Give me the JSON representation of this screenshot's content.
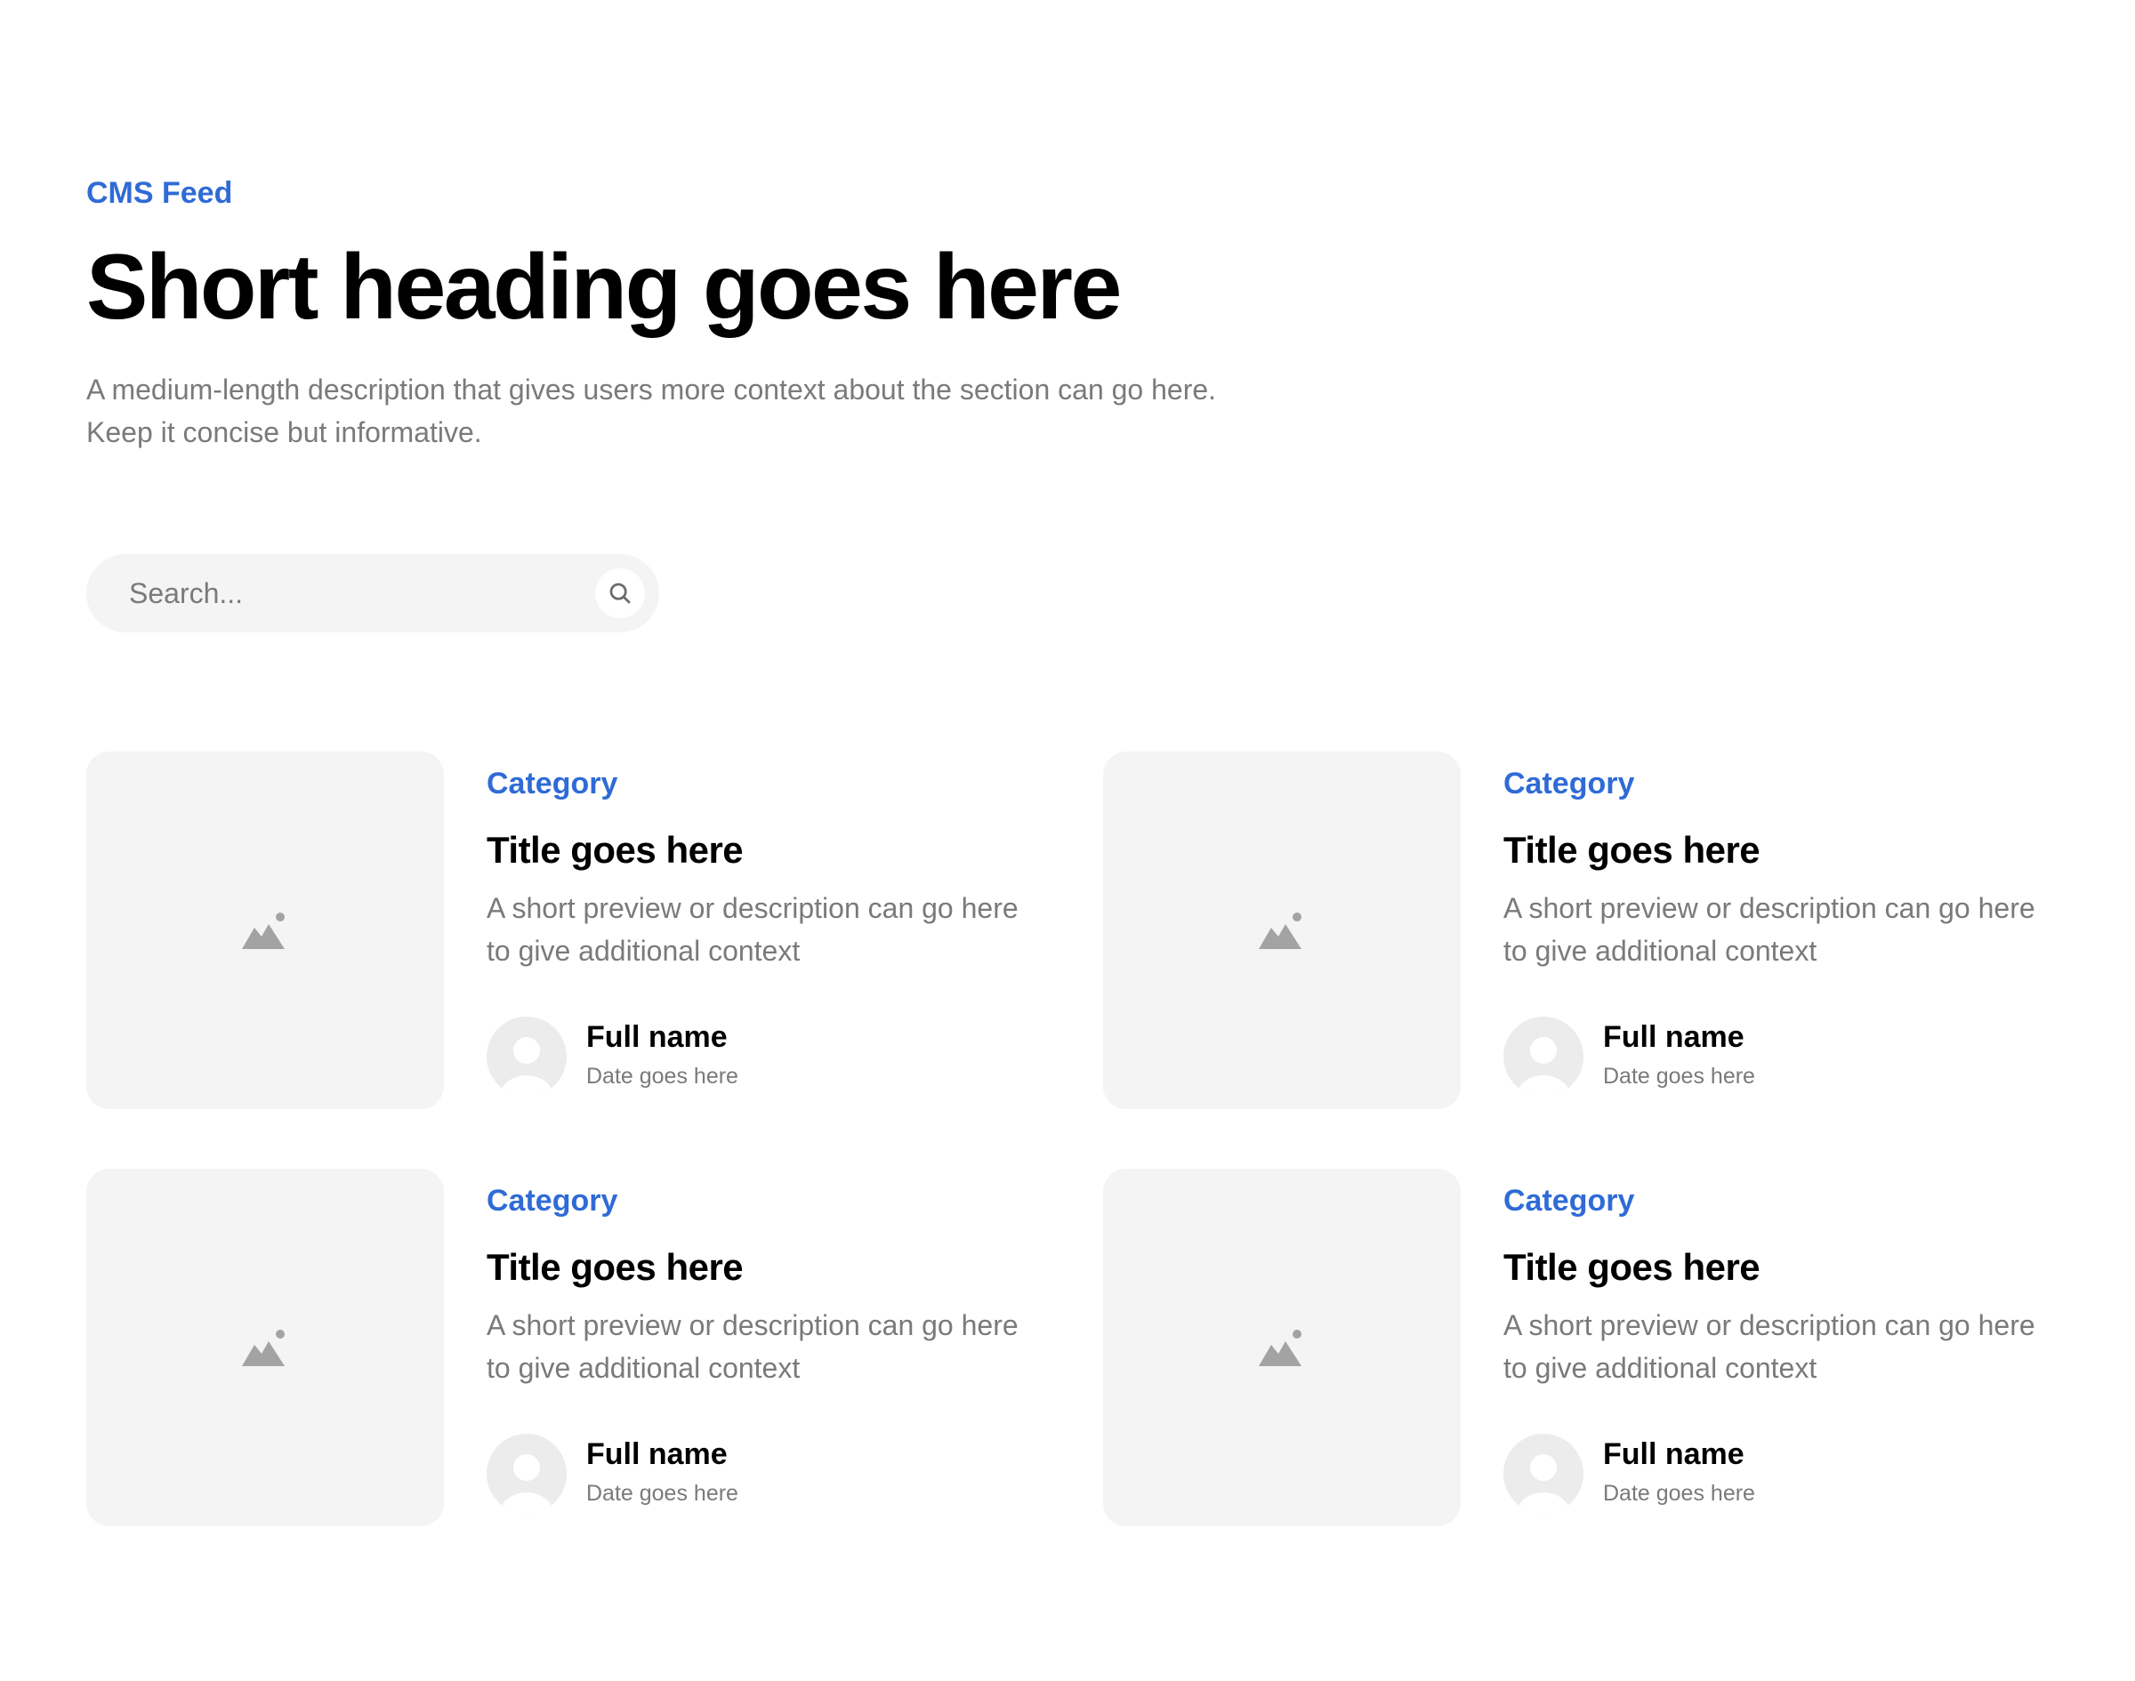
{
  "section": {
    "eyebrow": "CMS Feed",
    "heading": "Short heading goes here",
    "description": "A medium-length description that gives users more context about the section can go here. Keep it concise but informative."
  },
  "search": {
    "placeholder": "Search...",
    "icon": "search-icon"
  },
  "colors": {
    "accent": "#2f6bd6",
    "muted_text": "#7a7a7a",
    "placeholder_bg": "#f4f4f4",
    "icon_gray": "#a3a3a3"
  },
  "posts": [
    {
      "image_icon": "image-placeholder-icon",
      "category": "Category",
      "title": "Title goes here",
      "description": "A short preview or description can go here to give additional context",
      "author": {
        "name": "Full name",
        "date": "Date goes here",
        "avatar_icon": "user-avatar-icon"
      }
    },
    {
      "image_icon": "image-placeholder-icon",
      "category": "Category",
      "title": "Title goes here",
      "description": "A short preview or description can go here to give additional context",
      "author": {
        "name": "Full name",
        "date": "Date goes here",
        "avatar_icon": "user-avatar-icon"
      }
    },
    {
      "image_icon": "image-placeholder-icon",
      "category": "Category",
      "title": "Title goes here",
      "description": "A short preview or description can go here to give additional context",
      "author": {
        "name": "Full name",
        "date": "Date goes here",
        "avatar_icon": "user-avatar-icon"
      }
    },
    {
      "image_icon": "image-placeholder-icon",
      "category": "Category",
      "title": "Title goes here",
      "description": "A short preview or description can go here to give additional context",
      "author": {
        "name": "Full name",
        "date": "Date goes here",
        "avatar_icon": "user-avatar-icon"
      }
    }
  ]
}
